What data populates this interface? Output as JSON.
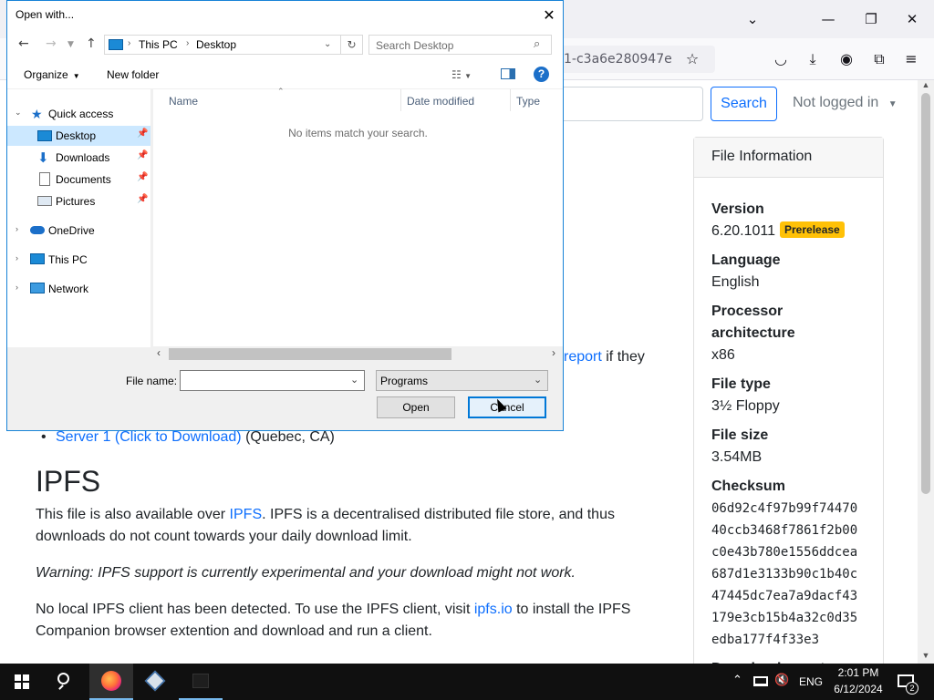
{
  "browser": {
    "url_fragment": "1-c3a6e280947e",
    "search_button": "Search",
    "login_status": "Not logged in",
    "file_info": {
      "header": "File Information",
      "version_label": "Version",
      "version_value": "6.20.1011",
      "version_badge": "Prerelease",
      "language_label": "Language",
      "language_value": "English",
      "arch_label": "Processor architecture",
      "arch_value": "x86",
      "filetype_label": "File type",
      "filetype_value": "3½ Floppy",
      "filesize_label": "File size",
      "filesize_value": "3.54MB",
      "checksum_label": "Checksum",
      "checksum_lines": [
        "06d92c4f97b99f74470",
        "40ccb3468f7861f2b00",
        "c0e43b780e1556ddcea",
        "687d1e3133b90c1b40c",
        "47445dc7ea7a9dacf43",
        "179e3cb15b4a32c0d35",
        "edba177f4f33e3"
      ],
      "download_count_label": "Download count"
    },
    "content": {
      "report_link": "report",
      "report_tail": " if they",
      "server_link": "Server 1 (Click to Download)",
      "server_location": " (Quebec, CA)",
      "ipfs_heading": "IPFS",
      "p1_a": "This file is also available over ",
      "p1_link": "IPFS",
      "p1_b": ". IPFS is a decentralised distributed file store, and thus downloads do not count towards your daily download limit.",
      "warning": "Warning: IPFS support is currently experimental and your download might not work.",
      "p3_a": "No local IPFS client has been detected. To use the IPFS client, visit ",
      "p3_link": "ipfs.io",
      "p3_b": " to install the IPFS Companion browser extention and download and run a client."
    }
  },
  "dialog": {
    "title": "Open with...",
    "breadcrumb": [
      "This PC",
      "Desktop"
    ],
    "search_placeholder": "Search Desktop",
    "toolbar": {
      "organize": "Organize",
      "new_folder": "New folder"
    },
    "nav_items": {
      "quick_access": "Quick access",
      "desktop": "Desktop",
      "downloads": "Downloads",
      "documents": "Documents",
      "pictures": "Pictures",
      "onedrive": "OneDrive",
      "this_pc": "This PC",
      "network": "Network"
    },
    "columns": {
      "name": "Name",
      "date_modified": "Date modified",
      "type": "Type"
    },
    "empty_message": "No items match your search.",
    "file_name_label": "File name:",
    "file_name_value": "",
    "file_type_value": "Programs",
    "open_button": "Open",
    "cancel_button": "Cancel"
  },
  "taskbar": {
    "language": "ENG",
    "time": "2:01 PM",
    "date": "6/12/2024",
    "notification_count": "2"
  }
}
